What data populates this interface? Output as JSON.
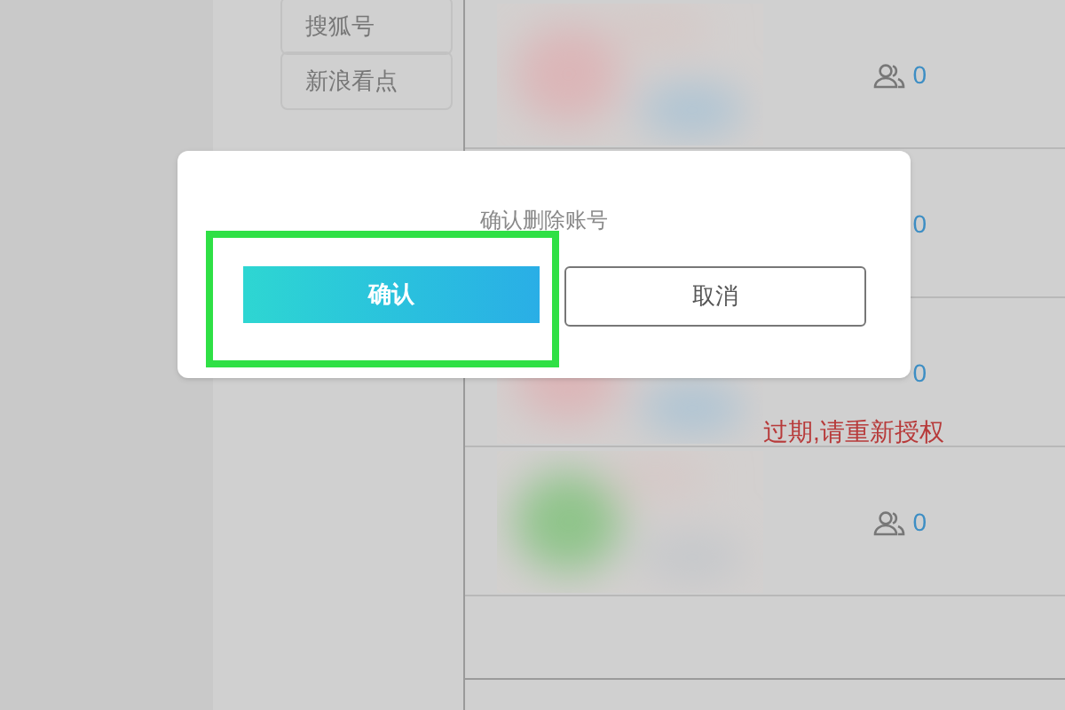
{
  "sidebar": {
    "items": [
      {
        "label": "搜狐号"
      },
      {
        "label": "新浪看点"
      }
    ]
  },
  "accounts": [
    {
      "count": "0",
      "icon": true
    },
    {
      "count": "0"
    },
    {
      "count": "0",
      "icon": false,
      "message": "过期,请重新授权"
    },
    {
      "count": "0",
      "icon": true
    }
  ],
  "dialog": {
    "title": "确认删除账号",
    "buttons": [
      {
        "label": "确认",
        "kind": "primary",
        "highlighted": true
      },
      {
        "label": "取消",
        "kind": "secondary",
        "highlighted": false
      }
    ]
  }
}
